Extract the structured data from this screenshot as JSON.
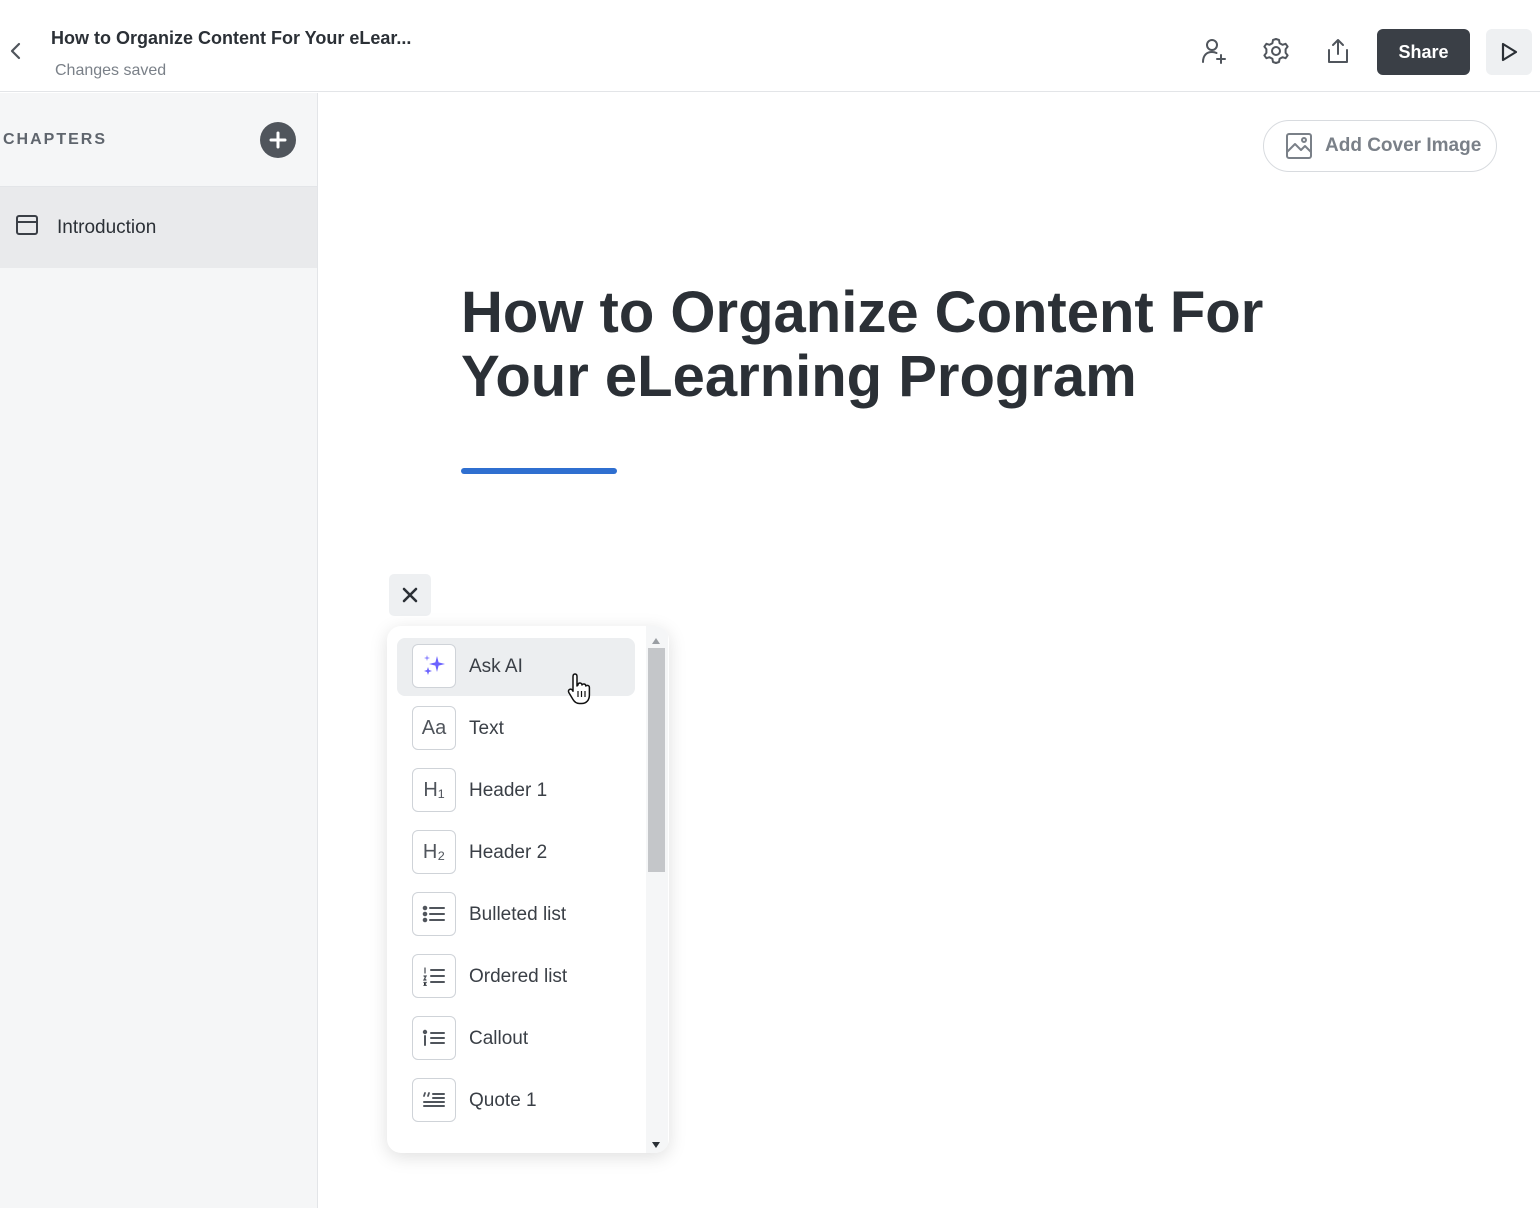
{
  "header": {
    "doc_title": "How to Organize Content For Your eLear...",
    "save_status": "Changes saved",
    "share_label": "Share",
    "icons": [
      "back-chevron-icon",
      "add-user-icon",
      "gear-icon",
      "upload-icon",
      "play-icon"
    ]
  },
  "sidebar": {
    "chapters_label": "CHAPTERS",
    "chapters": [
      {
        "label": "Introduction",
        "icon": "chapter-page-icon",
        "selected": true
      }
    ]
  },
  "main": {
    "cover_button_label": "Add Cover Image",
    "title": "How to Organize Content For Your eLearning Program",
    "accent_color": "#2f6fd0"
  },
  "block_menu": {
    "items": [
      {
        "label": "Ask AI",
        "icon": "sparkles-icon",
        "glyph": ""
      },
      {
        "label": "Text",
        "icon": "text-icon",
        "glyph": "Aa"
      },
      {
        "label": "Header 1",
        "icon": "header-1-icon",
        "glyph": "H₁"
      },
      {
        "label": "Header 2",
        "icon": "header-2-icon",
        "glyph": "H₂"
      },
      {
        "label": "Bulleted list",
        "icon": "bulleted-list-icon",
        "glyph": ""
      },
      {
        "label": "Ordered list",
        "icon": "ordered-list-icon",
        "glyph": ""
      },
      {
        "label": "Callout",
        "icon": "callout-icon",
        "glyph": ""
      },
      {
        "label": "Quote 1",
        "icon": "quote-icon",
        "glyph": ""
      }
    ]
  }
}
